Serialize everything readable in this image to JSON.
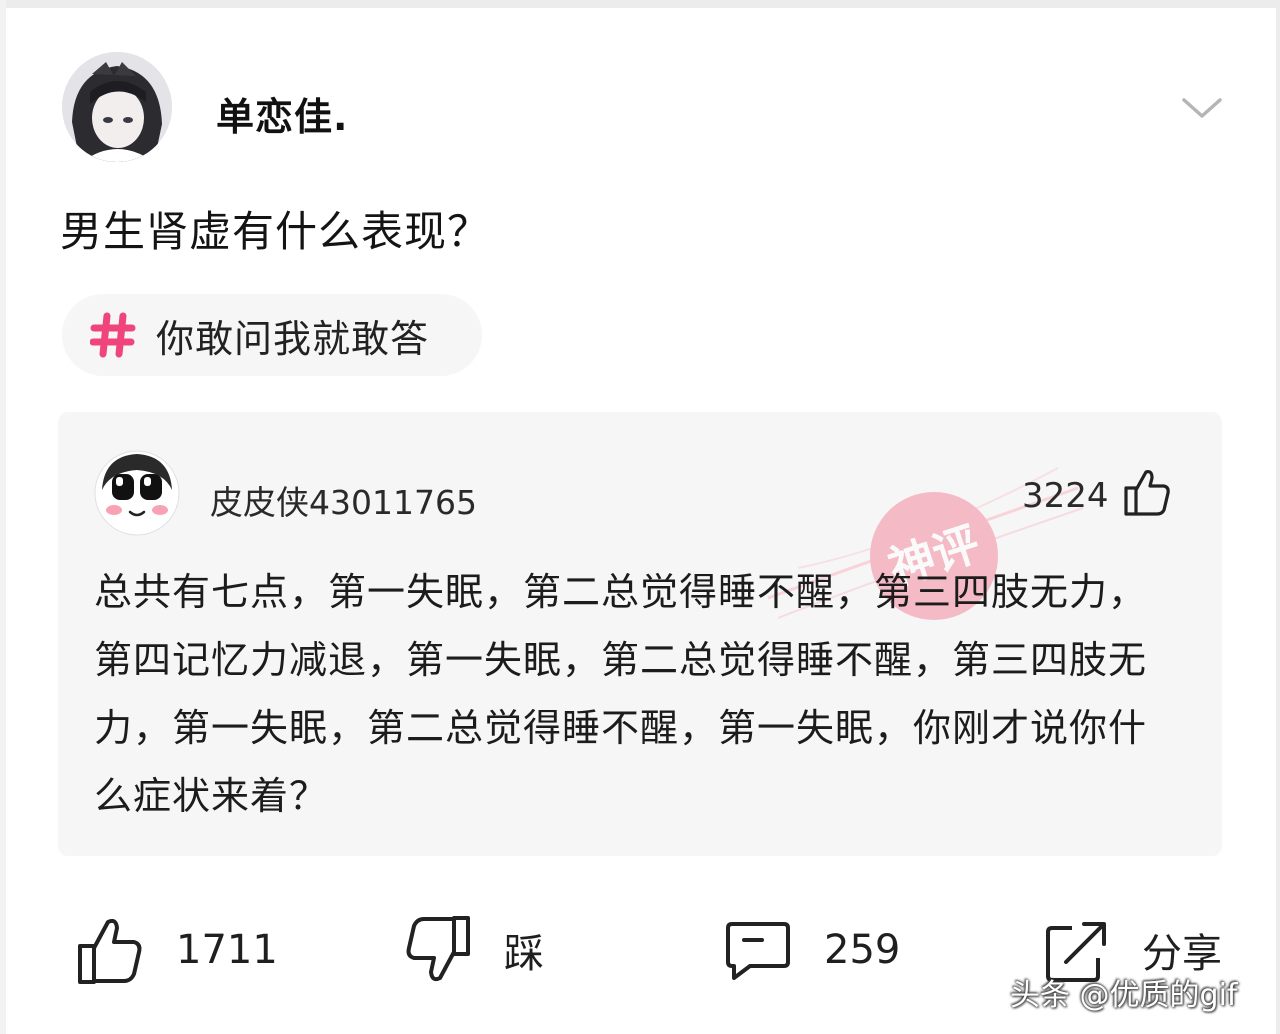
{
  "post": {
    "author": "单恋佳.",
    "question": "男生肾虚有什么表现？",
    "topic": "你敢问我就敢答"
  },
  "answer": {
    "user": "皮皮侠43011765",
    "likes": "3224",
    "text": "总共有七点，第一失眠，第二总觉得睡不醒，第三四肢无力，第四记忆力减退，第一失眠，第二总觉得睡不醒，第三四肢无力，第一失眠，第二总觉得睡不醒，第一失眠，你刚才说你什么症状来着？",
    "watermark_text": "神评"
  },
  "actions": {
    "upvote_count": "1711",
    "downvote_label": "踩",
    "comment_count": "259",
    "share_label": "分享"
  },
  "credit": "头条 @优质的gif",
  "colors": {
    "background": "#ffffff",
    "card": "#f6f6f7",
    "chip": "#f6f6f7",
    "hash_accent": "#f0457a",
    "watermark": "#f48a9e"
  },
  "icons": {
    "expand": "chevron-down-icon",
    "topic": "hash-icon",
    "like": "thumbs-up-icon",
    "dislike": "thumbs-down-icon",
    "comment": "comment-icon",
    "share": "share-icon"
  }
}
